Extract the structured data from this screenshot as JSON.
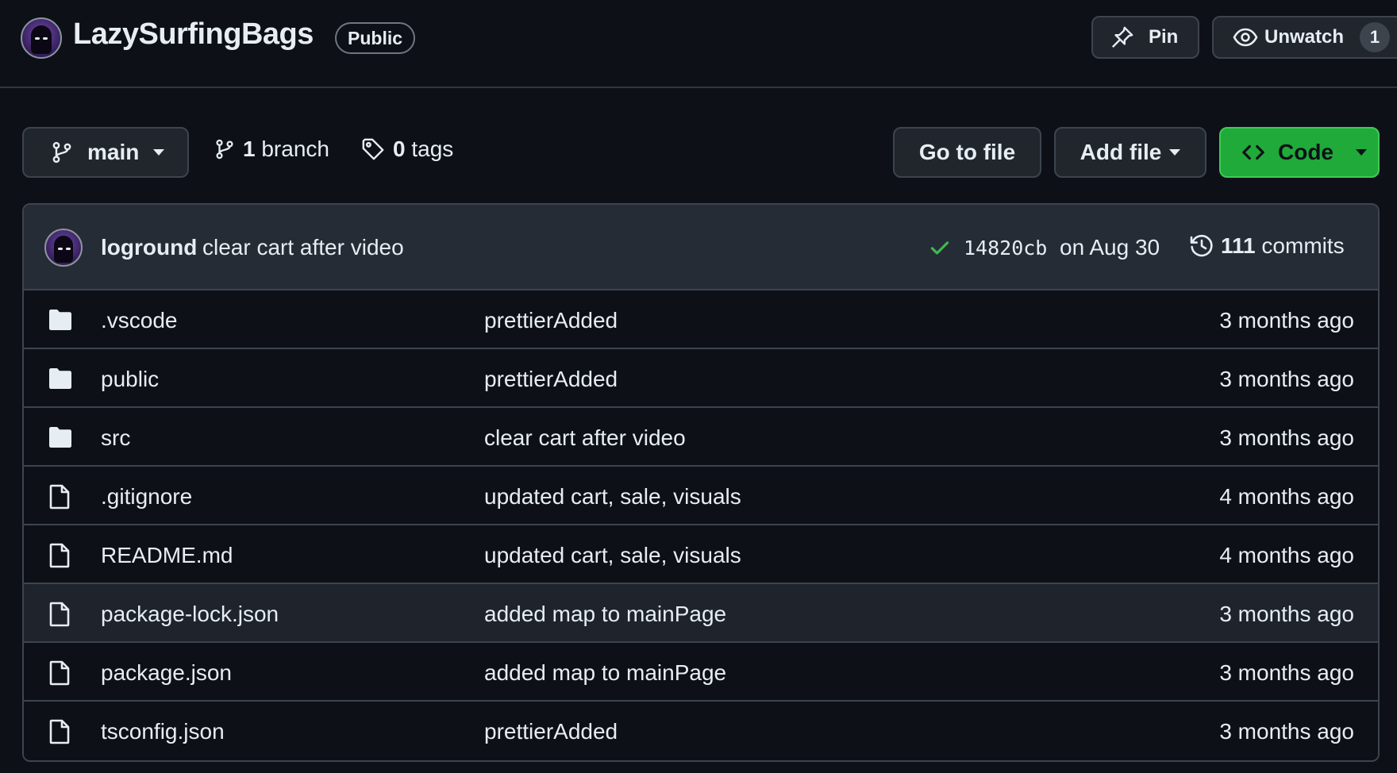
{
  "repo": {
    "name": "LazySurfingBags",
    "visibility": "Public"
  },
  "actions": {
    "pin_label": "Pin",
    "unwatch_label": "Unwatch",
    "watch_count": "1"
  },
  "toolbar": {
    "branch_name": "main",
    "branch_count": "1",
    "branch_word": "branch",
    "tag_count": "0",
    "tag_word": "tags",
    "goto_file_label": "Go to file",
    "add_file_label": "Add file",
    "code_label": "Code"
  },
  "latest_commit": {
    "author": "loground",
    "message": "clear cart after video",
    "sha": "14820cb",
    "date": "on Aug 30",
    "commit_count": "111",
    "commit_word": "commits",
    "status_color": "#3fb950"
  },
  "files": [
    {
      "type": "folder",
      "name": ".vscode",
      "message": "prettierAdded",
      "age": "3 months ago"
    },
    {
      "type": "folder",
      "name": "public",
      "message": "prettierAdded",
      "age": "3 months ago"
    },
    {
      "type": "folder",
      "name": "src",
      "message": "clear cart after video",
      "age": "3 months ago"
    },
    {
      "type": "file",
      "name": ".gitignore",
      "message": "updated cart, sale, visuals",
      "age": "4 months ago"
    },
    {
      "type": "file",
      "name": "README.md",
      "message": "updated cart, sale, visuals",
      "age": "4 months ago"
    },
    {
      "type": "file",
      "name": "package-lock.json",
      "message": "added map to mainPage",
      "age": "3 months ago"
    },
    {
      "type": "file",
      "name": "package.json",
      "message": "added map to mainPage",
      "age": "3 months ago"
    },
    {
      "type": "file",
      "name": "tsconfig.json",
      "message": "prettierAdded",
      "age": "3 months ago"
    }
  ],
  "colors": {
    "background": "#0d1117",
    "border": "#3d444d",
    "code_button": "#1faa3a",
    "commit_bar": "#262c36"
  }
}
